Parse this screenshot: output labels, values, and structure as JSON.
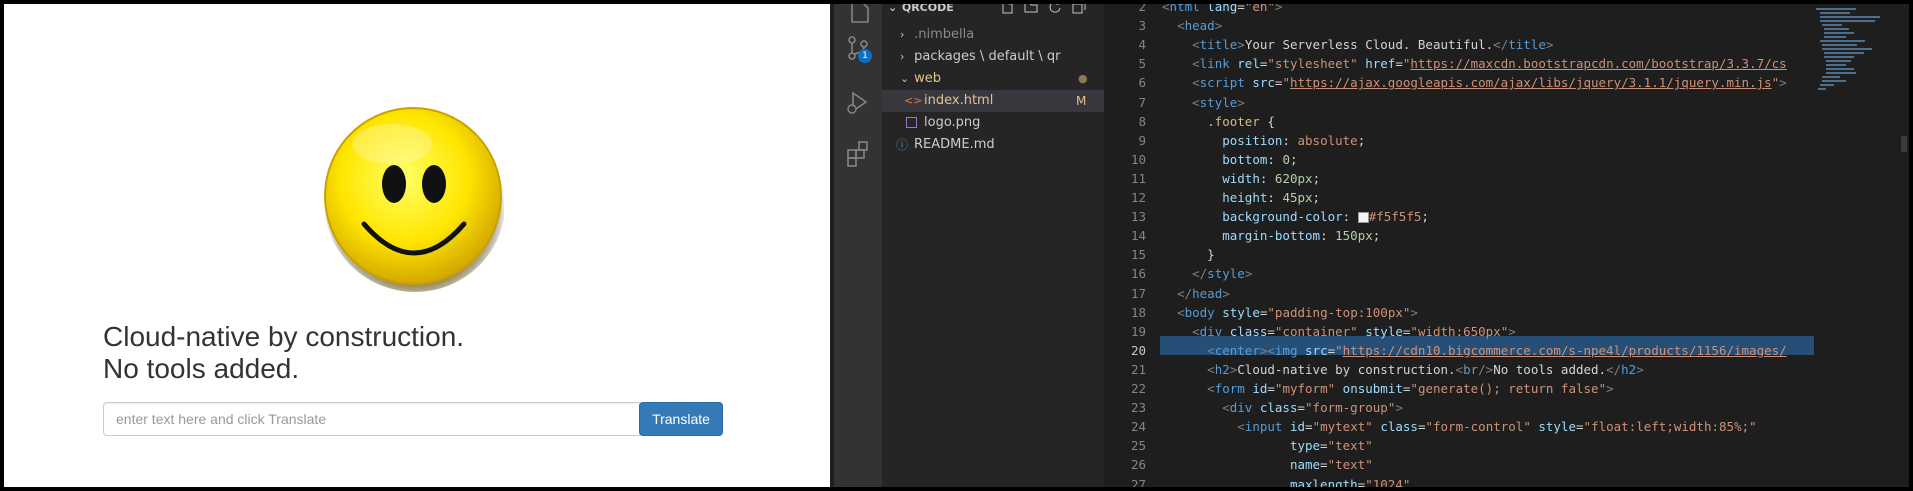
{
  "browser": {
    "heading_line1": "Cloud-native by construction.",
    "heading_line2": "No tools added.",
    "input_placeholder": "enter text here and click Translate",
    "translate_label": "Translate",
    "button_color": "#337ab7"
  },
  "activity_bar": {
    "source_control_badge": "1",
    "icons": [
      "files-icon",
      "source-control-icon",
      "run-debug-icon",
      "extensions-icon"
    ]
  },
  "explorer": {
    "title": "QRCODE",
    "items": [
      {
        "label": ".nimbella",
        "kind": "folder"
      },
      {
        "label": "packages \\ default \\ qr",
        "kind": "folder"
      },
      {
        "label": "web",
        "kind": "folder-open",
        "badge": "●"
      },
      {
        "label": "index.html",
        "kind": "html-file",
        "badge": "M"
      },
      {
        "label": "logo.png",
        "kind": "image-file"
      },
      {
        "label": "README.md",
        "kind": "info-file"
      }
    ]
  },
  "editor": {
    "lines": [
      {
        "n": "2",
        "html": "<span class='punc'>&lt;</span><span class='tag'>html</span> <span class='attr'>lang</span>=<span class='str'>\"en\"</span><span class='punc'>&gt;</span>"
      },
      {
        "n": "3",
        "html": "  <span class='punc'>&lt;</span><span class='tag'>head</span><span class='punc'>&gt;</span>"
      },
      {
        "n": "4",
        "html": "    <span class='punc'>&lt;</span><span class='tag'>title</span><span class='punc'>&gt;</span>Your Serverless Cloud. Beautiful.<span class='punc'>&lt;/</span><span class='tag'>title</span><span class='punc'>&gt;</span>"
      },
      {
        "n": "5",
        "html": "    <span class='punc'>&lt;</span><span class='tag'>link</span> <span class='attr'>rel</span>=<span class='str'>\"stylesheet\"</span> <span class='attr'>href</span>=<span class='str'>\"<span class='url'>https://maxcdn.bootstrapcdn.com/bootstrap/3.3.7/cs</span></span>"
      },
      {
        "n": "6",
        "html": "    <span class='punc'>&lt;</span><span class='tag'>script</span> <span class='attr'>src</span>=<span class='str'>\"<span class='url'>https://ajax.googleapis.com/ajax/libs/jquery/3.1.1/jquery.min.js</span>\"</span><span class='punc'>&gt;</span>"
      },
      {
        "n": "7",
        "html": "    <span class='punc'>&lt;</span><span class='tag'>style</span><span class='punc'>&gt;</span>"
      },
      {
        "n": "8",
        "html": "      <span class='sel-c'>.footer</span> {"
      },
      {
        "n": "9",
        "html": "        <span class='prop'>position</span>: <span class='val'>absolute</span>;"
      },
      {
        "n": "10",
        "html": "        <span class='prop'>bottom</span>: <span class='num'>0</span>;"
      },
      {
        "n": "11",
        "html": "        <span class='prop'>width</span>: <span class='num'>620px</span>;"
      },
      {
        "n": "12",
        "html": "        <span class='prop'>height</span>: <span class='num'>45px</span>;"
      },
      {
        "n": "13",
        "html": "        <span class='prop'>background-color</span>: <span style='display:inline-block;width:9px;height:9px;background:#f5f5f5;border:1px solid #999;vertical-align:middle'></span><span class='val'>#f5f5f5</span>;"
      },
      {
        "n": "14",
        "html": "        <span class='prop'>margin-bottom</span>: <span class='num'>150px</span>;"
      },
      {
        "n": "15",
        "html": "      }"
      },
      {
        "n": "16",
        "html": "    <span class='punc'>&lt;/</span><span class='tag'>style</span><span class='punc'>&gt;</span>"
      },
      {
        "n": "17",
        "html": "  <span class='punc'>&lt;/</span><span class='tag'>head</span><span class='punc'>&gt;</span>"
      },
      {
        "n": "18",
        "html": "  <span class='punc'>&lt;</span><span class='tag'>body</span> <span class='attr'>style</span>=<span class='str'>\"padding-top:100px\"</span><span class='punc'>&gt;</span>"
      },
      {
        "n": "19",
        "html": "    <span class='punc'>&lt;</span><span class='tag'>div</span> <span class='attr'>class</span>=<span class='str'>\"container\"</span> <span class='attr'>style</span>=<span class='str'>\"width:650px\"</span><span class='punc'>&gt;</span>"
      },
      {
        "n": "20",
        "html": "      <span class='punc'>&lt;</span><span class='tag'>center</span><span class='punc'>&gt;&lt;</span><span class='tag'>img</span> <span class='attr'>src</span>=<span class='str'>\"<span class='url'>https://cdn10.bigcommerce.com/s-npe4l/products/1156/images/</span></span>"
      },
      {
        "n": "21",
        "html": "      <span class='punc'>&lt;</span><span class='tag'>h2</span><span class='punc'>&gt;</span>Cloud-native by construction.<span class='punc'>&lt;</span><span class='tag'>br</span><span class='punc'>/&gt;</span>No tools added.<span class='punc'>&lt;/</span><span class='tag'>h2</span><span class='punc'>&gt;</span>"
      },
      {
        "n": "22",
        "html": "      <span class='punc'>&lt;</span><span class='tag'>form</span> <span class='attr'>id</span>=<span class='str'>\"myform\"</span> <span class='attr'>onsubmit</span>=<span class='str'>\"generate(); return false\"</span><span class='punc'>&gt;</span>"
      },
      {
        "n": "23",
        "html": "        <span class='punc'>&lt;</span><span class='tag'>div</span> <span class='attr'>class</span>=<span class='str'>\"form-group\"</span><span class='punc'>&gt;</span>"
      },
      {
        "n": "24",
        "html": "          <span class='punc'>&lt;</span><span class='tag'>input</span> <span class='attr'>id</span>=<span class='str'>\"mytext\"</span> <span class='attr'>class</span>=<span class='str'>\"form-control\"</span> <span class='attr'>style</span>=<span class='str'>\"float:left;width:85%;\"</span>"
      },
      {
        "n": "25",
        "html": "                 <span class='attr'>type</span>=<span class='str'>\"text\"</span>"
      },
      {
        "n": "26",
        "html": "                 <span class='attr'>name</span>=<span class='str'>\"text\"</span>"
      },
      {
        "n": "27",
        "html": "                 <span class='attr'>maxlength</span>=<span class='str'>\"1024\"</span>"
      }
    ],
    "highlighted_line": "20"
  }
}
